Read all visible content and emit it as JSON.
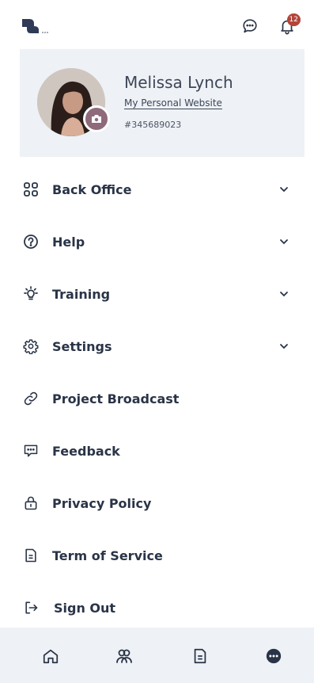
{
  "topbar": {
    "logo_icon": "brand-logo-icon",
    "chat_icon": "chat-bubble-icon",
    "bell_icon": "bell-icon",
    "notification_count": "12"
  },
  "profile": {
    "name": "Melissa Lynch",
    "website_link": "My Personal Website",
    "member_id": "#345689023",
    "avatar_icon": "avatar-photo",
    "camera_icon": "camera-icon"
  },
  "menu": [
    {
      "label": "Back Office",
      "icon": "grid-icon",
      "expandable": true
    },
    {
      "label": "Help",
      "icon": "help-circle-icon",
      "expandable": true
    },
    {
      "label": "Training",
      "icon": "lightbulb-icon",
      "expandable": true
    },
    {
      "label": "Settings",
      "icon": "gear-icon",
      "expandable": true
    },
    {
      "label": "Project Broadcast",
      "icon": "link-icon",
      "expandable": false
    },
    {
      "label": "Feedback",
      "icon": "feedback-icon",
      "expandable": false
    },
    {
      "label": "Privacy Policy",
      "icon": "lock-icon",
      "expandable": false
    },
    {
      "label": "Term of Service",
      "icon": "document-icon",
      "expandable": false
    },
    {
      "label": "Sign Out",
      "icon": "sign-out-icon",
      "expandable": false
    }
  ],
  "bottom_nav": [
    {
      "icon": "home-icon"
    },
    {
      "icon": "team-icon"
    },
    {
      "icon": "document-icon"
    },
    {
      "icon": "more-icon"
    }
  ],
  "colors": {
    "text": "#2a3447",
    "panel_bg": "#eef1f5",
    "badge": "#b3443b",
    "camera_bg": "#8e6a7a"
  }
}
